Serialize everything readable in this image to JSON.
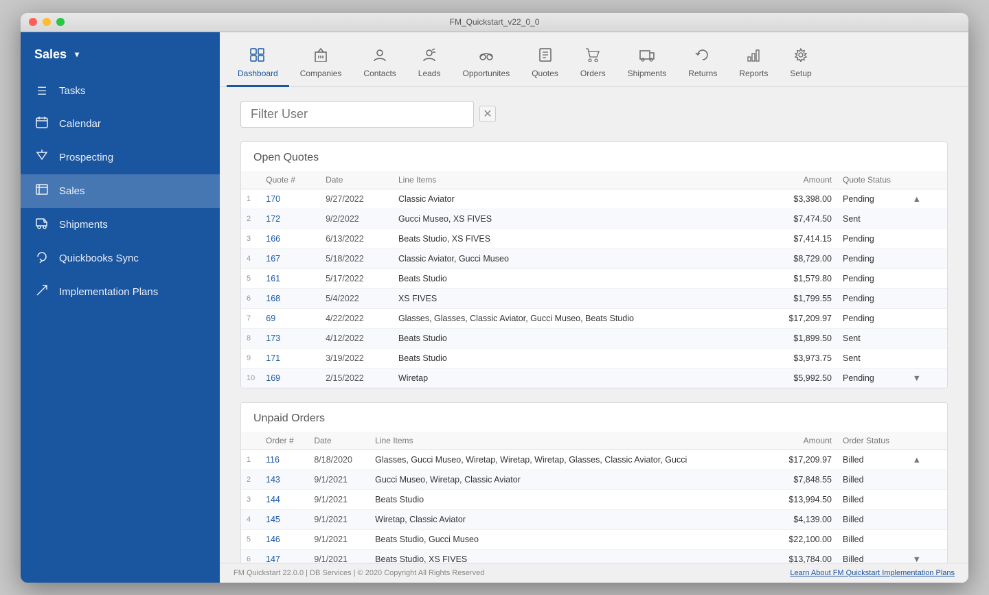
{
  "window": {
    "title": "FM_Quickstart_v22_0_0"
  },
  "sidebar": {
    "header_label": "Sales",
    "chevron": "▾",
    "items": [
      {
        "id": "tasks",
        "label": "Tasks",
        "icon": "☰"
      },
      {
        "id": "calendar",
        "label": "Calendar",
        "icon": "📅"
      },
      {
        "id": "prospecting",
        "label": "Prospecting",
        "icon": "🔽"
      },
      {
        "id": "sales",
        "label": "Sales",
        "icon": "💰"
      },
      {
        "id": "shipments",
        "label": "Shipments",
        "icon": "📦"
      },
      {
        "id": "quickbooks",
        "label": "Quickbooks Sync",
        "icon": "🔄"
      },
      {
        "id": "implementation",
        "label": "Implementation Plans",
        "icon": "✏️"
      }
    ]
  },
  "topnav": {
    "items": [
      {
        "id": "dashboard",
        "label": "Dashboard",
        "icon": "⊞",
        "active": true
      },
      {
        "id": "companies",
        "label": "Companies",
        "icon": "🏢"
      },
      {
        "id": "contacts",
        "label": "Contacts",
        "icon": "👤"
      },
      {
        "id": "leads",
        "label": "Leads",
        "icon": "📌"
      },
      {
        "id": "opportunities",
        "label": "Opportunites",
        "icon": "🤝"
      },
      {
        "id": "quotes",
        "label": "Quotes",
        "icon": "📋"
      },
      {
        "id": "orders",
        "label": "Orders",
        "icon": "🛒"
      },
      {
        "id": "shipments",
        "label": "Shipments",
        "icon": "🚚"
      },
      {
        "id": "returns",
        "label": "Returns",
        "icon": "↩"
      },
      {
        "id": "reports",
        "label": "Reports",
        "icon": "📊"
      },
      {
        "id": "setup",
        "label": "Setup",
        "icon": "⚙"
      }
    ]
  },
  "filter": {
    "placeholder": "Filter User",
    "clear_label": "✕"
  },
  "open_quotes": {
    "title": "Open Quotes",
    "columns": [
      "Quote #",
      "Date",
      "Line Items",
      "Amount",
      "Quote Status"
    ],
    "rows": [
      {
        "num": 1,
        "quote": "170",
        "date": "9/27/2022",
        "items": "Classic Aviator",
        "amount": "$3,398.00",
        "status": "Pending"
      },
      {
        "num": 2,
        "quote": "172",
        "date": "9/2/2022",
        "items": "Gucci Museo, XS FIVES",
        "amount": "$7,474.50",
        "status": "Sent"
      },
      {
        "num": 3,
        "quote": "166",
        "date": "6/13/2022",
        "items": "Beats Studio, XS FIVES",
        "amount": "$7,414.15",
        "status": "Pending"
      },
      {
        "num": 4,
        "quote": "167",
        "date": "5/18/2022",
        "items": "Classic Aviator, Gucci Museo",
        "amount": "$8,729.00",
        "status": "Pending"
      },
      {
        "num": 5,
        "quote": "161",
        "date": "5/17/2022",
        "items": "Beats Studio",
        "amount": "$1,579.80",
        "status": "Pending"
      },
      {
        "num": 6,
        "quote": "168",
        "date": "5/4/2022",
        "items": "XS FIVES",
        "amount": "$1,799.55",
        "status": "Pending"
      },
      {
        "num": 7,
        "quote": "69",
        "date": "4/22/2022",
        "items": "Glasses, Glasses, Classic Aviator, Gucci Museo, Beats Studio",
        "amount": "$17,209.97",
        "status": "Pending"
      },
      {
        "num": 8,
        "quote": "173",
        "date": "4/12/2022",
        "items": "Beats Studio",
        "amount": "$1,899.50",
        "status": "Sent"
      },
      {
        "num": 9,
        "quote": "171",
        "date": "3/19/2022",
        "items": "Beats Studio",
        "amount": "$3,973.75",
        "status": "Sent"
      },
      {
        "num": 10,
        "quote": "169",
        "date": "2/15/2022",
        "items": "Wiretap",
        "amount": "$5,992.50",
        "status": "Pending"
      }
    ]
  },
  "unpaid_orders": {
    "title": "Unpaid Orders",
    "columns": [
      "Order #",
      "Date",
      "Line Items",
      "Amount",
      "Order Status"
    ],
    "rows": [
      {
        "num": 1,
        "order": "116",
        "date": "8/18/2020",
        "items": "Glasses, Gucci Museo, Wiretap, Wiretap, Wiretap, Glasses, Classic Aviator, Gucci",
        "amount": "$17,209.97",
        "status": "Billed"
      },
      {
        "num": 2,
        "order": "143",
        "date": "9/1/2021",
        "items": "Gucci Museo, Wiretap, Classic Aviator",
        "amount": "$7,848.55",
        "status": "Billed"
      },
      {
        "num": 3,
        "order": "144",
        "date": "9/1/2021",
        "items": "Beats Studio",
        "amount": "$13,994.50",
        "status": "Billed"
      },
      {
        "num": 4,
        "order": "145",
        "date": "9/1/2021",
        "items": "Wiretap, Classic Aviator",
        "amount": "$4,139.00",
        "status": "Billed"
      },
      {
        "num": 5,
        "order": "146",
        "date": "9/1/2021",
        "items": "Beats Studio, Gucci Museo",
        "amount": "$22,100.00",
        "status": "Billed"
      },
      {
        "num": 6,
        "order": "147",
        "date": "9/1/2021",
        "items": "Beats Studio, XS FIVES",
        "amount": "$13,784.00",
        "status": "Billed"
      }
    ]
  },
  "footer": {
    "left": "FM Quickstart 22.0.0  |  DB Services  |  © 2020 Copyright All Rights Reserved",
    "link": "Learn About FM Quickstart Implementation Plans"
  }
}
